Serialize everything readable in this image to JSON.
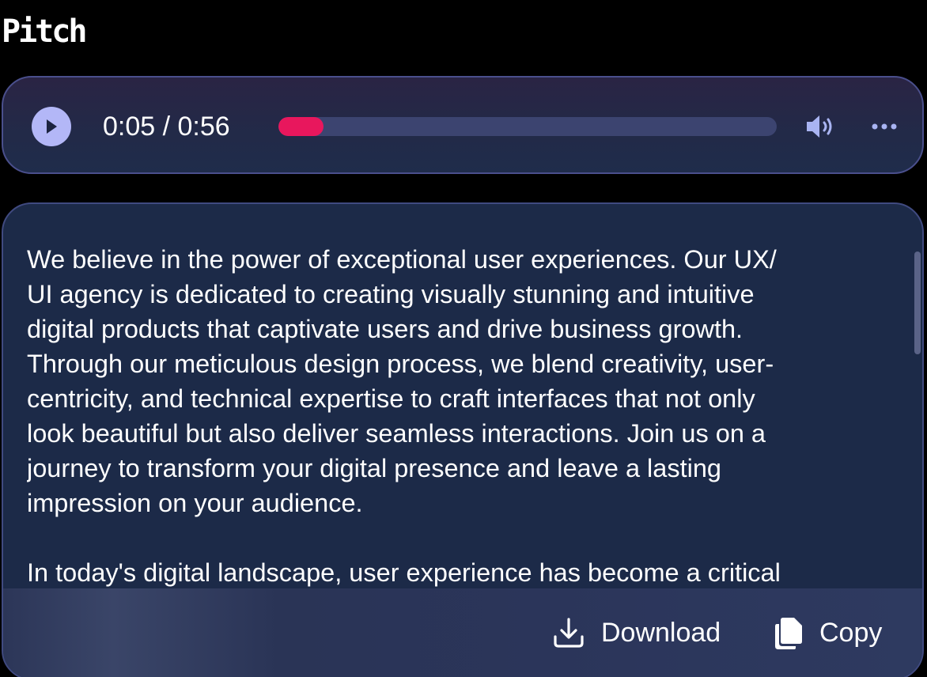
{
  "app": {
    "logo_text": "Pitch"
  },
  "player": {
    "current_time": "0:05",
    "duration": "0:56",
    "time_display": "0:05 / 0:56",
    "progress_fraction": 0.09,
    "accent_color": "#e8175d",
    "play_icon": "play-icon",
    "volume_icon": "volume-icon",
    "more_icon": "more-horizontal-icon"
  },
  "transcript": {
    "paragraphs": [
      "We believe in the power of exceptional user experiences. Our UX/\nUI agency is dedicated to creating visually stunning and intuitive\ndigital products that captivate users and drive business growth.\nThrough our meticulous design process, we blend creativity, user-\ncentricity, and technical expertise to craft interfaces that not only\nlook beautiful but also deliver seamless interactions. Join us on a\njourney to transform your digital presence and leave a lasting\nimpression on your audience.",
      "In today's digital landscape, user experience has become a critical"
    ]
  },
  "actions": {
    "download_label": "Download",
    "download_icon": "download-icon",
    "copy_label": "Copy",
    "copy_icon": "copy-icon"
  }
}
